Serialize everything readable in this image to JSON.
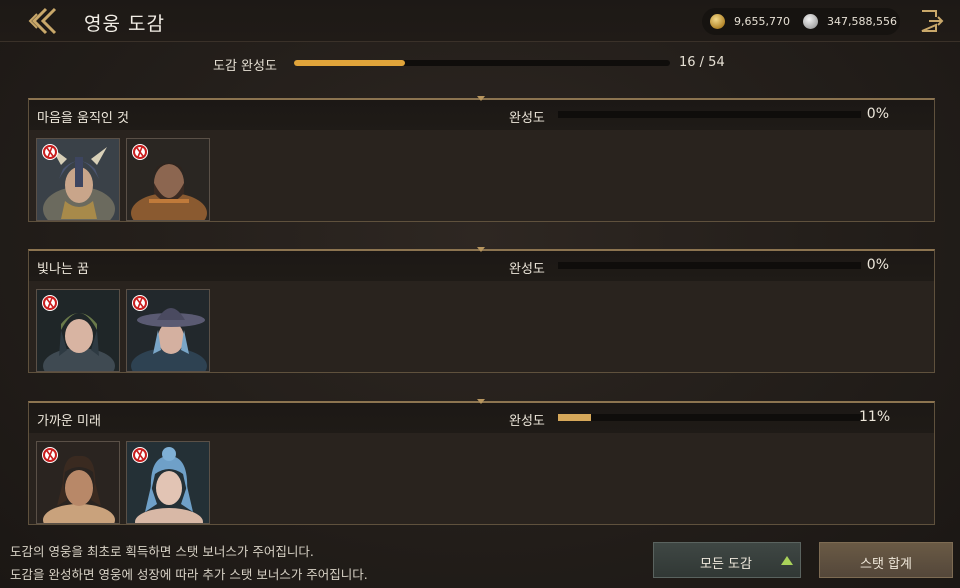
{
  "header": {
    "title": "영웅 도감",
    "gold": "9,655,770",
    "silver": "347,588,556"
  },
  "overall": {
    "label": "도감 완성도",
    "count": "16 / 54",
    "progress": 0.296
  },
  "sections": [
    {
      "title": "마음을 움직인 것",
      "progress_label": "완성도",
      "percent": "0%",
      "progress": 0.0,
      "heroes": [
        {
          "name": "horned-helmet-warrior"
        },
        {
          "name": "bearded-warrior"
        }
      ]
    },
    {
      "title": "빛나는 꿈",
      "progress_label": "완성도",
      "percent": "0%",
      "progress": 0.0,
      "heroes": [
        {
          "name": "helmet-girl"
        },
        {
          "name": "cowboy-hat-girl"
        }
      ]
    },
    {
      "title": "가까운 미래",
      "progress_label": "완성도",
      "percent": "11%",
      "progress": 0.11,
      "heroes": [
        {
          "name": "long-hair-man"
        },
        {
          "name": "blue-hair-woman"
        }
      ]
    }
  ],
  "footer": {
    "line1": "도감의 영웅을 최초로 획득하면 스탯 보너스가 주어집니다.",
    "line2": "도감을 완성하면 영웅에 성장에 따라 추가 스탯 보너스가 주어집니다.",
    "all_button": "모든 도감",
    "stat_button": "스탯 합계"
  },
  "colors": {
    "accent": "#e0a43a",
    "section_border": "#8c7450",
    "badge_red": "#c81e1e"
  },
  "icons": [
    "back-chevron-icon",
    "gold-coin-icon",
    "silver-coin-icon",
    "exit-icon",
    "hero-badge-icon",
    "triangle-up-icon"
  ]
}
